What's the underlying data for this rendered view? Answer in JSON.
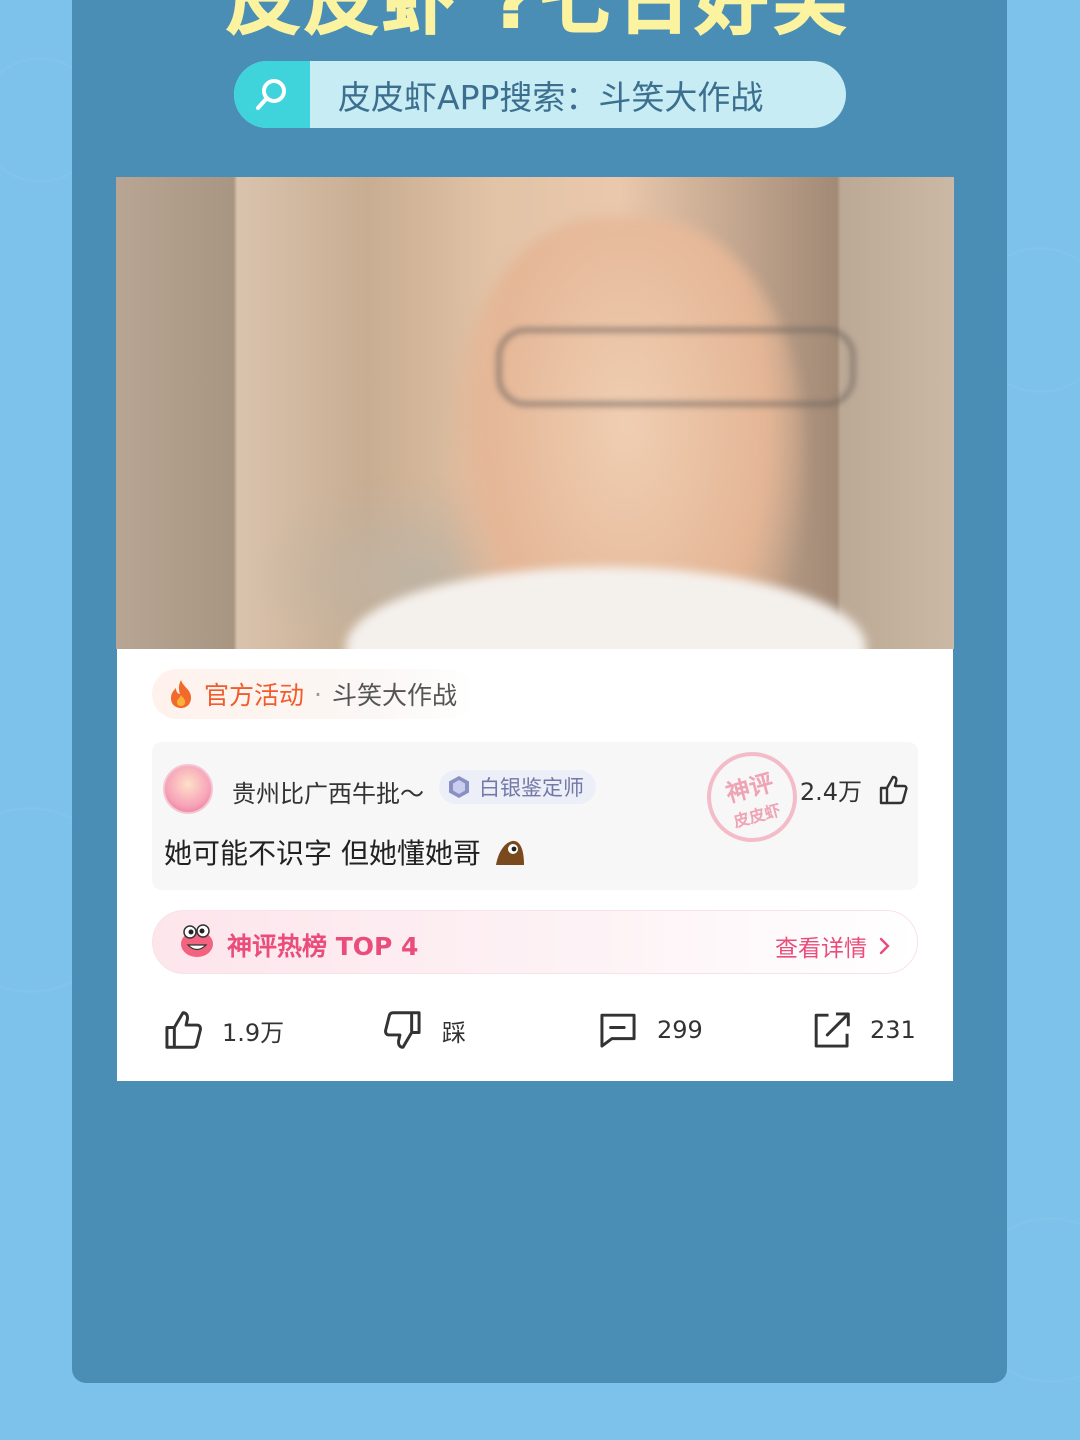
{
  "banner": {
    "headline": "皮皮虾 ?七日好笑",
    "search_text": "皮皮虾APP搜索：斗笑大作战"
  },
  "post": {
    "activity_tag": "官方活动",
    "activity_separator": "·",
    "activity_name": "斗笑大作战",
    "comment": {
      "username": "贵州比广西牛批～",
      "badge": "白银鉴定师",
      "stamp_line1": "神评",
      "stamp_line2": "皮皮虾",
      "likes": "2.4万",
      "text": "她可能不识字  但她懂她哥"
    },
    "hot_rank": {
      "title": "神评热榜 TOP 4",
      "detail": "查看详情"
    },
    "actions": {
      "like_count": "1.9万",
      "dislike_label": "踩",
      "comment_count": "299",
      "share_count": "231"
    }
  },
  "colors": {
    "background": "#7cc2ea",
    "panel": "#4a8db5",
    "headline": "#fbf3a0",
    "search_accent": "#3fd4dc",
    "activity_tag": "#f25b2b",
    "hot_pink": "#ea4d7b"
  },
  "icons": [
    "search-icon",
    "fire-icon",
    "badge-icon",
    "thumb-up-icon",
    "thumb-down-icon",
    "comment-icon",
    "share-icon",
    "chevron-right-icon",
    "laugh-emoji-icon"
  ]
}
